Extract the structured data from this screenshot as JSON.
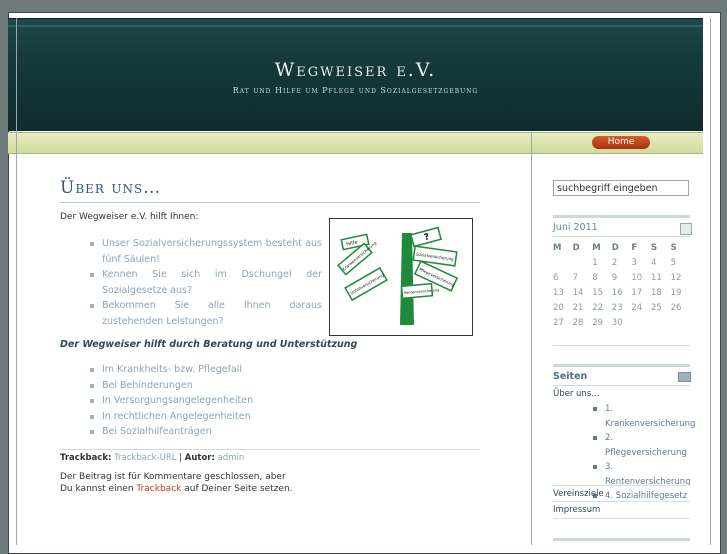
{
  "site": {
    "title": "Wegweiser e.V.",
    "tagline": "Rat und Hilfe um Pflege und Sozialgesetzgebung"
  },
  "nav": {
    "home_label": "Home"
  },
  "post": {
    "title": "Über uns…",
    "intro": "Der Wegweiser e.V. hilft Ihnen:",
    "list1": [
      "Unser Sozialversicherungssystem besteht aus fünf Säulen!",
      "Kennen Sie sich im Dschungel der Sozialgesetze aus?",
      "Bekommen Sie alle Ihnen daraus zustehenden Leistungen?"
    ],
    "subheading": "Der Wegweiser hilft durch Beratung und Unterstützung",
    "list2": [
      "Im Krankheits- bzw. Pflegefall",
      "Bei Behinderungen",
      "In Versorgungsangelegenheiten",
      "In rechtlichen Angelegenheiten",
      "Bei Sozialhilfeanträgen"
    ],
    "meta": {
      "trackback_label": "Trackback:",
      "trackback_link": "Trackback-URL",
      "separator": "|",
      "author_label": "Autor:",
      "author": "admin"
    },
    "closed_text_1": "Der Beitrag ist für Kommentare geschlossen, aber Du kannst einen",
    "closed_link": "Trackback",
    "closed_text_2": "auf Deiner Seite setzen.",
    "image_signs": [
      "Sozialversicherung",
      "Rentenversicherung",
      "Krankenversicherung",
      "Pflegeversicherung",
      "Unfallversicherung",
      "Hilfe",
      "?"
    ]
  },
  "sidebar": {
    "search_value": "suchbegriff eingeben",
    "calendar": {
      "caption": "Juni 2011",
      "weekdays": [
        "M",
        "D",
        "M",
        "D",
        "F",
        "S",
        "S"
      ],
      "weeks": [
        [
          "",
          "",
          "1",
          "2",
          "3",
          "4",
          "5"
        ],
        [
          "6",
          "7",
          "8",
          "9",
          "10",
          "11",
          "12"
        ],
        [
          "13",
          "14",
          "15",
          "16",
          "17",
          "18",
          "19"
        ],
        [
          "20",
          "21",
          "22",
          "23",
          "24",
          "25",
          "26"
        ],
        [
          "27",
          "28",
          "29",
          "30",
          "",
          "",
          ""
        ]
      ]
    },
    "pages_heading": "Seiten",
    "pages_parent": "Über uns…",
    "pages_children": [
      "1. Krankenversicherung",
      "2. Pflegeversicherung",
      "3. Rentenversicherung",
      "4. Sozialhilfegesetz"
    ],
    "pages_more": [
      "Vereinsziele",
      "Impressum"
    ]
  }
}
